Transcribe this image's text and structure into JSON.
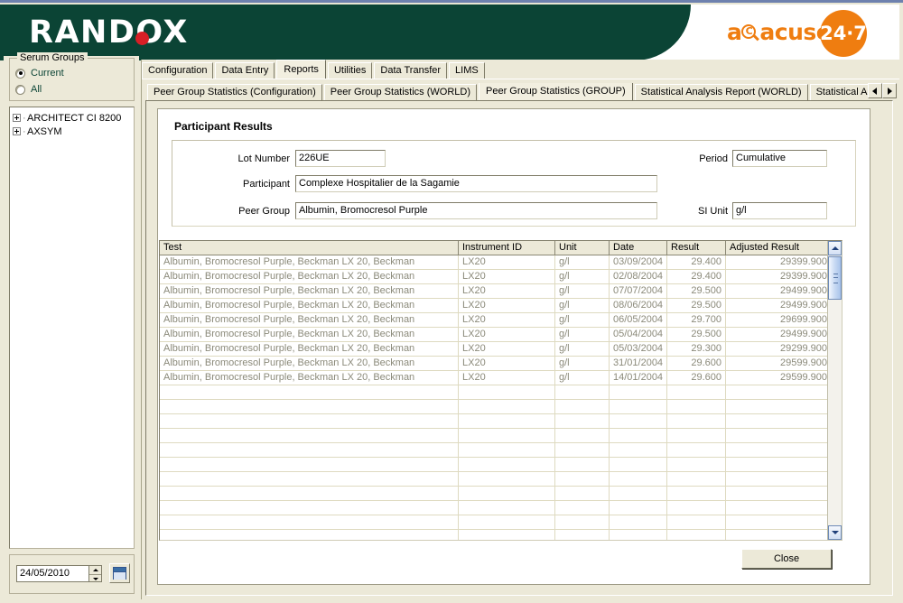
{
  "brand": {
    "name": "RANDOX",
    "product": "acusera",
    "product_tm": "™",
    "badge": "24·7",
    "magnifier_letter": "C",
    "banner_color": "#0b4435",
    "accent_color": "#ef7d10",
    "dot_color": "#d81f26"
  },
  "sidebar": {
    "groupbox_title": "Serum Groups",
    "radios": [
      {
        "label": "Current",
        "selected": true
      },
      {
        "label": "All",
        "selected": false
      }
    ],
    "tree": [
      {
        "label": "ARCHITECT CI 8200",
        "expandable": true
      },
      {
        "label": "AXSYM",
        "expandable": true
      }
    ],
    "date_value": "24/05/2010",
    "calendar_icon": "calendar-icon"
  },
  "tabs_primary": [
    {
      "label": "Configuration",
      "active": false
    },
    {
      "label": "Data Entry",
      "active": false
    },
    {
      "label": "Reports",
      "active": true
    },
    {
      "label": "Utilities",
      "active": false
    },
    {
      "label": "Data Transfer",
      "active": false
    },
    {
      "label": "LIMS",
      "active": false
    }
  ],
  "tabs_secondary": [
    {
      "label": "Peer Group Statistics (Configuration)",
      "active": false
    },
    {
      "label": "Peer Group Statistics (WORLD)",
      "active": false
    },
    {
      "label": "Peer Group Statistics (GROUP)",
      "active": true
    },
    {
      "label": "Statistical Analysis Report (WORLD)",
      "active": false
    },
    {
      "label": "Statistical Analysis Repo",
      "active": false
    }
  ],
  "tab_scroll": {
    "left_icon": "triangle-left-icon",
    "right_icon": "triangle-right-icon"
  },
  "panel": {
    "title": "Participant Results",
    "fields": {
      "lot_number": {
        "label": "Lot Number",
        "value": "226UE"
      },
      "participant": {
        "label": "Participant",
        "value": "Complexe Hospitalier de la Sagamie"
      },
      "peer_group": {
        "label": "Peer Group",
        "value": "Albumin, Bromocresol Purple"
      },
      "period": {
        "label": "Period",
        "value": "Cumulative"
      },
      "si_unit": {
        "label": "SI Unit",
        "value": "g/l"
      }
    }
  },
  "table": {
    "columns": [
      "Test",
      "Instrument ID",
      "Unit",
      "Date",
      "Result",
      "Adjusted Result"
    ],
    "rows": [
      [
        "Albumin, Bromocresol Purple, Beckman LX 20, Beckman",
        "LX20",
        "g/l",
        "03/09/2004",
        "29.400",
        "29399.900"
      ],
      [
        "Albumin, Bromocresol Purple, Beckman LX 20, Beckman",
        "LX20",
        "g/l",
        "02/08/2004",
        "29.400",
        "29399.900"
      ],
      [
        "Albumin, Bromocresol Purple, Beckman LX 20, Beckman",
        "LX20",
        "g/l",
        "07/07/2004",
        "29.500",
        "29499.900"
      ],
      [
        "Albumin, Bromocresol Purple, Beckman LX 20, Beckman",
        "LX20",
        "g/l",
        "08/06/2004",
        "29.500",
        "29499.900"
      ],
      [
        "Albumin, Bromocresol Purple, Beckman LX 20, Beckman",
        "LX20",
        "g/l",
        "06/05/2004",
        "29.700",
        "29699.900"
      ],
      [
        "Albumin, Bromocresol Purple, Beckman LX 20, Beckman",
        "LX20",
        "g/l",
        "05/04/2004",
        "29.500",
        "29499.900"
      ],
      [
        "Albumin, Bromocresol Purple, Beckman LX 20, Beckman",
        "LX20",
        "g/l",
        "05/03/2004",
        "29.300",
        "29299.900"
      ],
      [
        "Albumin, Bromocresol Purple, Beckman LX 20, Beckman",
        "LX20",
        "g/l",
        "31/01/2004",
        "29.600",
        "29599.900"
      ],
      [
        "Albumin, Bromocresol Purple, Beckman LX 20, Beckman",
        "LX20",
        "g/l",
        "14/01/2004",
        "29.600",
        "29599.900"
      ]
    ],
    "empty_row_count": 11,
    "scrollbar": {
      "up_icon": "chevron-up-icon",
      "down_icon": "chevron-down-icon"
    }
  },
  "buttons": {
    "close": "Close"
  }
}
